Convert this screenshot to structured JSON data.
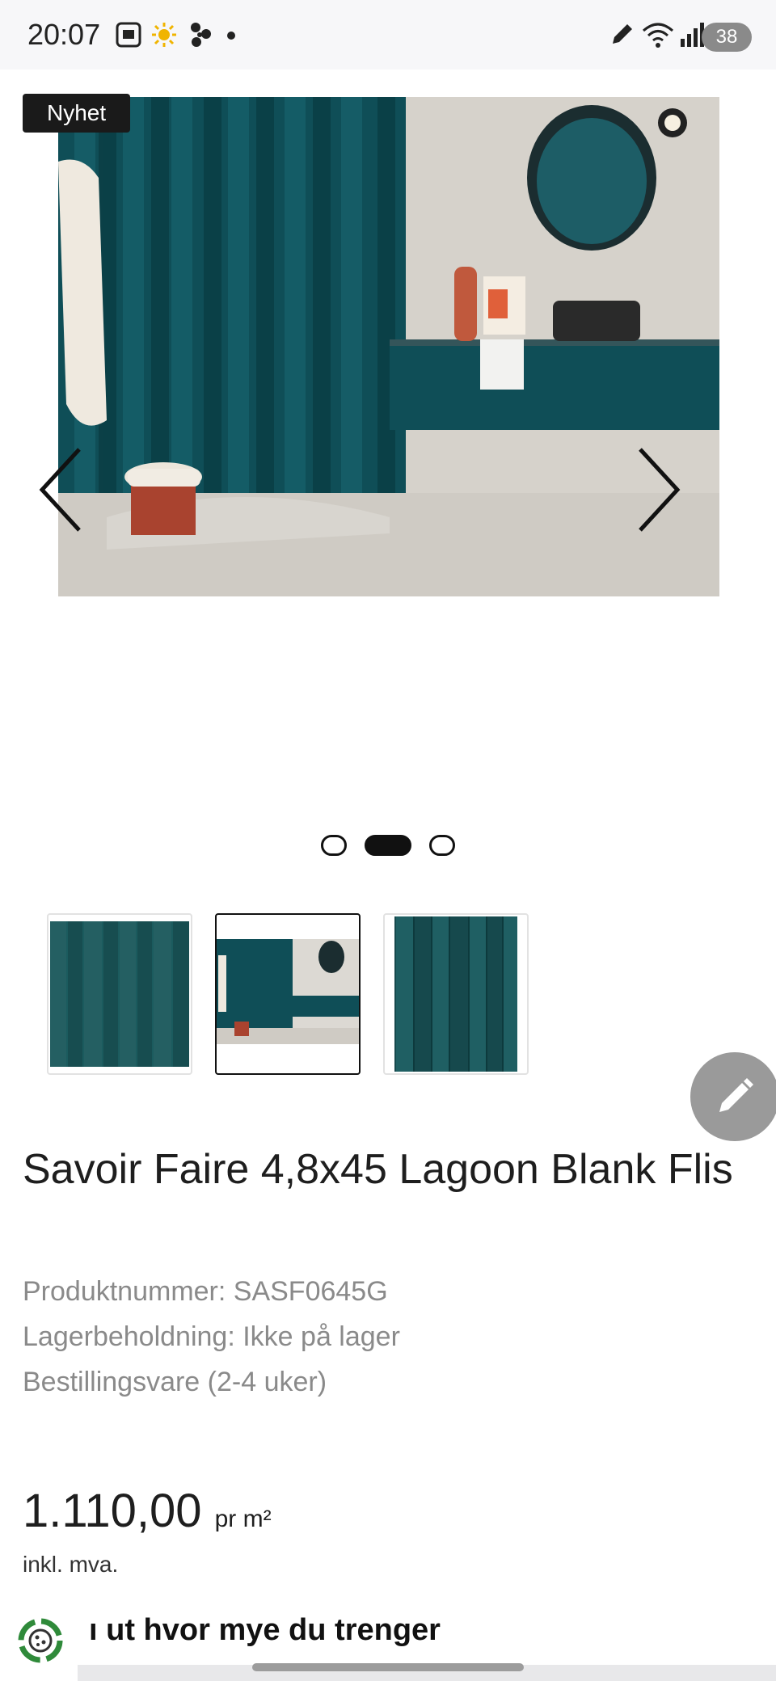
{
  "status_bar": {
    "time": "20:07",
    "battery": "38",
    "icons": [
      "screenshot-icon",
      "weather-sun-icon",
      "fan-icon",
      "dot-icon",
      "edit-icon",
      "wifi-icon",
      "signal-icon",
      "battery-icon"
    ]
  },
  "gallery": {
    "badge": "Nyhet",
    "slide_count": 3,
    "active_slide": 1
  },
  "thumbnails": [
    {
      "name": "thumb-tile-closeup"
    },
    {
      "name": "thumb-bathroom-scene"
    },
    {
      "name": "thumb-tile-panel"
    }
  ],
  "product": {
    "title": "Savoir Faire 4,8x45 Lagoon Blank Flis",
    "product_number": "Produktnummer: SASF0645G",
    "stock": "Lagerbeholdning: Ikke på lager",
    "order_info": "Bestillingsvare (2-4 uker)",
    "price": "1.110,00",
    "price_unit": "pr m²",
    "vat_note": "inkl. mva."
  },
  "calculator": {
    "label": "ı ut hvor mye du trenger"
  },
  "colors": {
    "tile_teal": "#0f4e57",
    "fab_gray": "#9a9a9a"
  }
}
